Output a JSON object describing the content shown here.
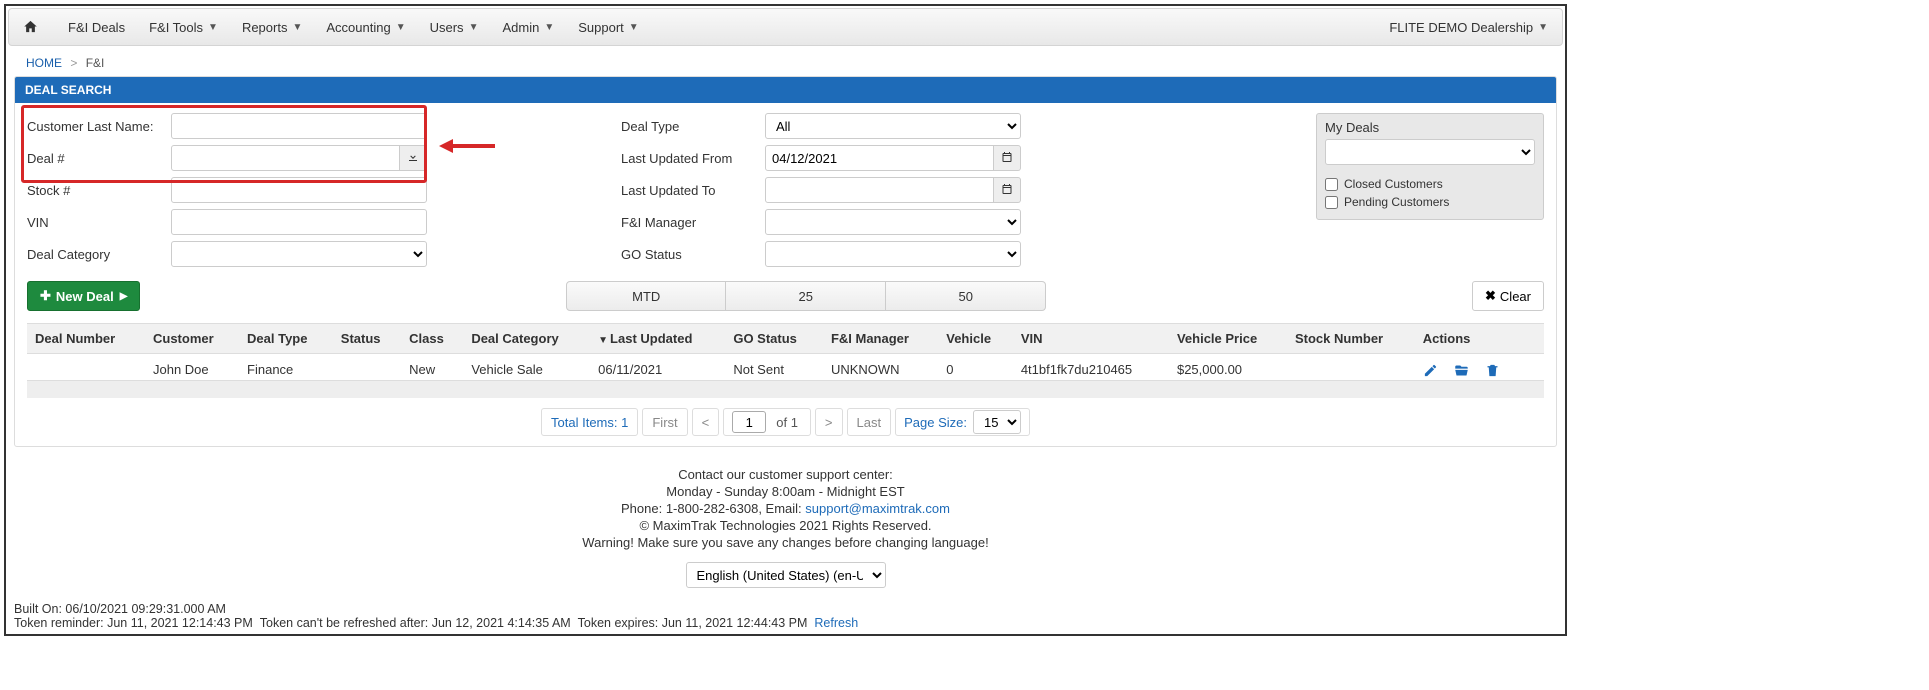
{
  "nav": {
    "items": [
      "F&I Deals",
      "F&I Tools",
      "Reports",
      "Accounting",
      "Users",
      "Admin",
      "Support"
    ],
    "has_caret": [
      false,
      true,
      true,
      true,
      true,
      true,
      true
    ],
    "dealer": "FLITE DEMO Dealership"
  },
  "breadcrumb": {
    "home": "HOME",
    "current": "F&I"
  },
  "panel": {
    "title": "DEAL SEARCH"
  },
  "search": {
    "col1": {
      "customer_last_name_label": "Customer Last Name:",
      "deal_num_label": "Deal #",
      "stock_num_label": "Stock #",
      "vin_label": "VIN",
      "deal_category_label": "Deal Category"
    },
    "col2": {
      "deal_type_label": "Deal Type",
      "deal_type_value": "All",
      "last_updated_from_label": "Last Updated From",
      "last_updated_from_value": "04/12/2021",
      "last_updated_to_label": "Last Updated To",
      "fi_manager_label": "F&I Manager",
      "go_status_label": "GO Status"
    },
    "mydeals": {
      "title": "My Deals",
      "closed": "Closed Customers",
      "pending": "Pending Customers"
    }
  },
  "actions": {
    "new_deal": "New Deal",
    "mtd": "MTD",
    "b25": "25",
    "b50": "50",
    "clear": "Clear"
  },
  "table": {
    "headers": [
      "Deal Number",
      "Customer",
      "Deal Type",
      "Status",
      "Class",
      "Deal Category",
      "Last Updated",
      "GO Status",
      "F&I Manager",
      "Vehicle",
      "VIN",
      "Vehicle Price",
      "Stock Number",
      "Actions"
    ],
    "rows": [
      {
        "deal_number": "",
        "customer": "John Doe",
        "deal_type": "Finance",
        "status": "",
        "class": "New",
        "deal_category": "Vehicle Sale",
        "last_updated": "06/11/2021",
        "go_status": "Not Sent",
        "fi_manager": "UNKNOWN",
        "vehicle": "0",
        "vin": "4t1bf1fk7du210465",
        "vehicle_price": "$25,000.00",
        "stock_number": ""
      }
    ]
  },
  "pagination": {
    "total_items_label": "Total Items:",
    "total_items": "1",
    "first": "First",
    "last": "Last",
    "of_label": "of 1",
    "page_value": "1",
    "page_size_label": "Page Size:",
    "page_size_value": "15"
  },
  "footer": {
    "line1": "Contact our customer support center:",
    "line2": "Monday - Sunday 8:00am - Midnight EST",
    "phone_prefix": "Phone: 1-800-282-6308, Email: ",
    "email": "support@maximtrak.com",
    "copyright": "© MaximTrak Technologies 2021 Rights Reserved.",
    "warning": "Warning! Make sure you save any changes before changing language!",
    "language": "English (United States) (en-US)"
  },
  "build": {
    "built_on": "Built On: 06/10/2021 09:29:31.000 AM",
    "token_line_1": "Token reminder: Jun 11, 2021 12:14:43 PM",
    "token_line_2": "Token can't be refreshed after: Jun 12, 2021 4:14:35 AM",
    "token_line_3": "Token expires: Jun 11, 2021 12:44:43 PM",
    "refresh": "Refresh"
  }
}
